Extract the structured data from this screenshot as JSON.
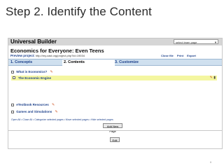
{
  "slide": {
    "title": "Step 2. Identify the Content",
    "page_number": "6"
  },
  "app": {
    "title": "Universal Builder",
    "team_select_value": "select team page"
  },
  "course": {
    "title": "Economics for Everyone: Even Teens",
    "preview_label": "Preview project:",
    "preview_url": "http://my.cast.org/project.php?id=19034",
    "links": [
      "Close file",
      "Print",
      "Export"
    ]
  },
  "tabs": [
    "1. Concepts",
    "2. Contents",
    "3. Customize"
  ],
  "content": {
    "sections": [
      {
        "label": "What is Economics?"
      },
      {
        "label": "eTextbook Resources"
      },
      {
        "label": "Games and Simulations"
      }
    ],
    "highlight_row_label": "The Economic Engine",
    "footer_links": "Open All • Close All • Categorize selected pages • Move selected pages • Hide selected pages",
    "add_button": "Add New Page",
    "edit_button": "Edit"
  },
  "colors": {
    "header_bg": "#d6d6d6",
    "tab_bg": "#cfe0ef",
    "highlight_bg": "#f4f6a0",
    "link": "#1b3f8a"
  }
}
